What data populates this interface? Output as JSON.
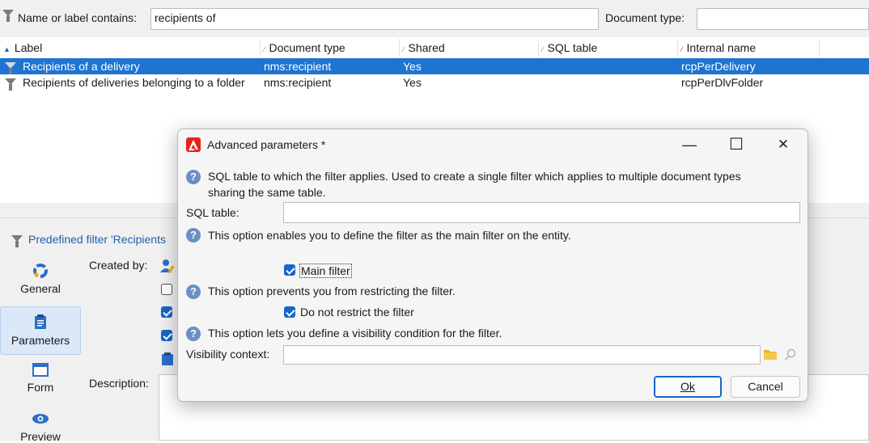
{
  "filter_bar": {
    "name_label": "Name or label contains:",
    "name_value": "recipients of",
    "doctype_label": "Document type:",
    "doctype_value": ""
  },
  "grid": {
    "columns": [
      "Label",
      "Document type",
      "Shared",
      "SQL table",
      "Internal name"
    ],
    "rows": [
      {
        "label": "Recipients of a delivery",
        "doctype": "nms:recipient",
        "shared": "Yes",
        "sqltable": "",
        "internal": "rcpPerDelivery",
        "selected": true
      },
      {
        "label": "Recipients of deliveries belonging to a folder",
        "doctype": "nms:recipient",
        "shared": "Yes",
        "sqltable": "",
        "internal": "rcpPerDlvFolder",
        "selected": false
      }
    ]
  },
  "lower": {
    "header": "Predefined filter 'Recipients",
    "nav": [
      {
        "label": "General",
        "icon": "general-icon"
      },
      {
        "label": "Parameters",
        "icon": "clipboard-icon"
      },
      {
        "label": "Form",
        "icon": "form-icon"
      },
      {
        "label": "Preview",
        "icon": "eye-icon"
      }
    ],
    "created_by_label": "Created by:",
    "description_label": "Description:"
  },
  "dialog": {
    "title": "Advanced parameters *",
    "help_sql": "SQL table to which the filter applies. Used to create a single filter which applies to multiple document types",
    "help_sql_2": "sharing the same table.",
    "sql_table_label": "SQL table:",
    "sql_table_value": "",
    "help_main": "This option enables you to define the filter as the main filter on the entity.",
    "main_filter_label": "Main filter",
    "main_filter_checked": true,
    "help_restrict": "This option prevents you from restricting the filter.",
    "no_restrict_label": "Do not restrict the filter",
    "no_restrict_checked": true,
    "help_visibility": "This option lets you define a visibility condition for the filter.",
    "visibility_label": "Visibility context:",
    "visibility_value": "",
    "ok_label": "Ok",
    "cancel_label": "Cancel",
    "minimize_glyph": "—",
    "maximize_glyph": "☐",
    "close_glyph": "✕"
  },
  "colors": {
    "selection": "#1e74d0",
    "accent_blue": "#1666c9",
    "adobe_red": "#e1251b",
    "help_icon": "#6b8fc4",
    "folder": "#e6b422"
  }
}
